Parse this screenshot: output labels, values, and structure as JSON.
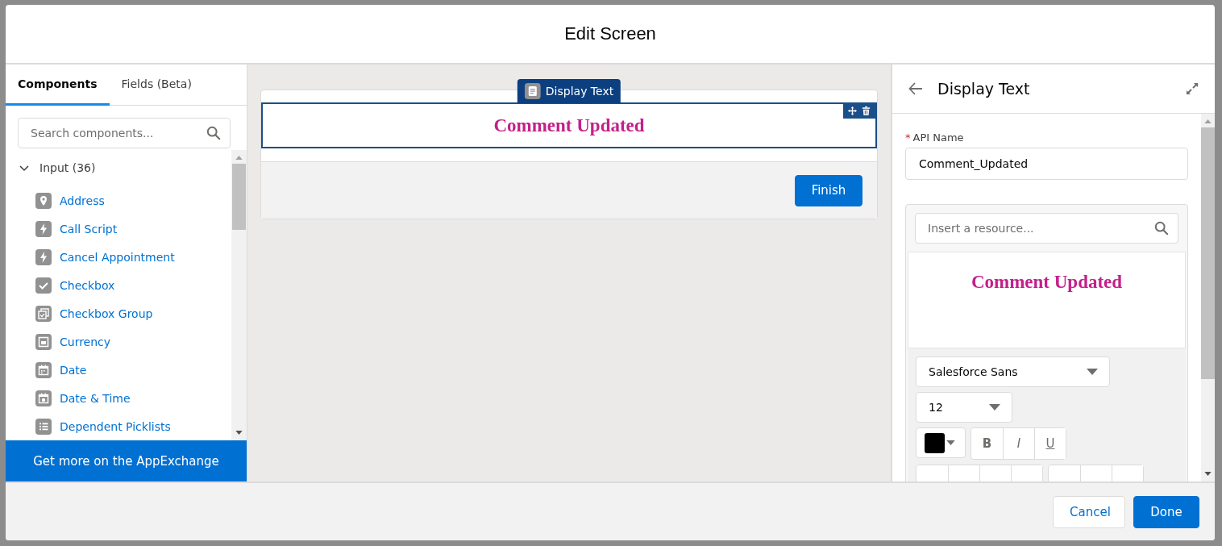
{
  "window": {
    "title": "Edit Screen"
  },
  "left_panel": {
    "tabs": [
      {
        "label": "Components",
        "selected": true
      },
      {
        "label": "Fields (Beta)",
        "selected": false
      }
    ],
    "search": {
      "placeholder": "Search components..."
    },
    "section": {
      "label": "Input (36)",
      "expanded": true
    },
    "components": [
      {
        "label": "Address",
        "kind": "pin"
      },
      {
        "label": "Call Script",
        "kind": "bolt"
      },
      {
        "label": "Cancel Appointment",
        "kind": "bolt"
      },
      {
        "label": "Checkbox",
        "kind": "check"
      },
      {
        "label": "Checkbox Group",
        "kind": "check-group"
      },
      {
        "label": "Currency",
        "kind": "currency"
      },
      {
        "label": "Date",
        "kind": "calendar"
      },
      {
        "label": "Date & Time",
        "kind": "calendar-clock"
      },
      {
        "label": "Dependent Picklists",
        "kind": "list"
      }
    ],
    "footer_link": "Get more on the AppExchange"
  },
  "canvas": {
    "selected_component": {
      "tab_label": "Display Text",
      "text": "Comment Updated"
    },
    "button": "Finish"
  },
  "properties": {
    "title": "Display Text",
    "api_name": {
      "required_mark": "*",
      "label": "API Name",
      "value": "Comment_Updated"
    },
    "editor": {
      "search": {
        "placeholder": "Insert a resource..."
      },
      "preview_text": "Comment Updated",
      "font": "Salesforce Sans",
      "size": "12",
      "format_buttons": [
        {
          "label": "B",
          "kind": "bold"
        },
        {
          "label": "I",
          "kind": "italic"
        },
        {
          "label": "U",
          "kind": "underline"
        }
      ]
    }
  },
  "footer": {
    "buttons": [
      {
        "label": "Cancel",
        "kind": "neutral"
      },
      {
        "label": "Done",
        "kind": "brand"
      }
    ]
  }
}
